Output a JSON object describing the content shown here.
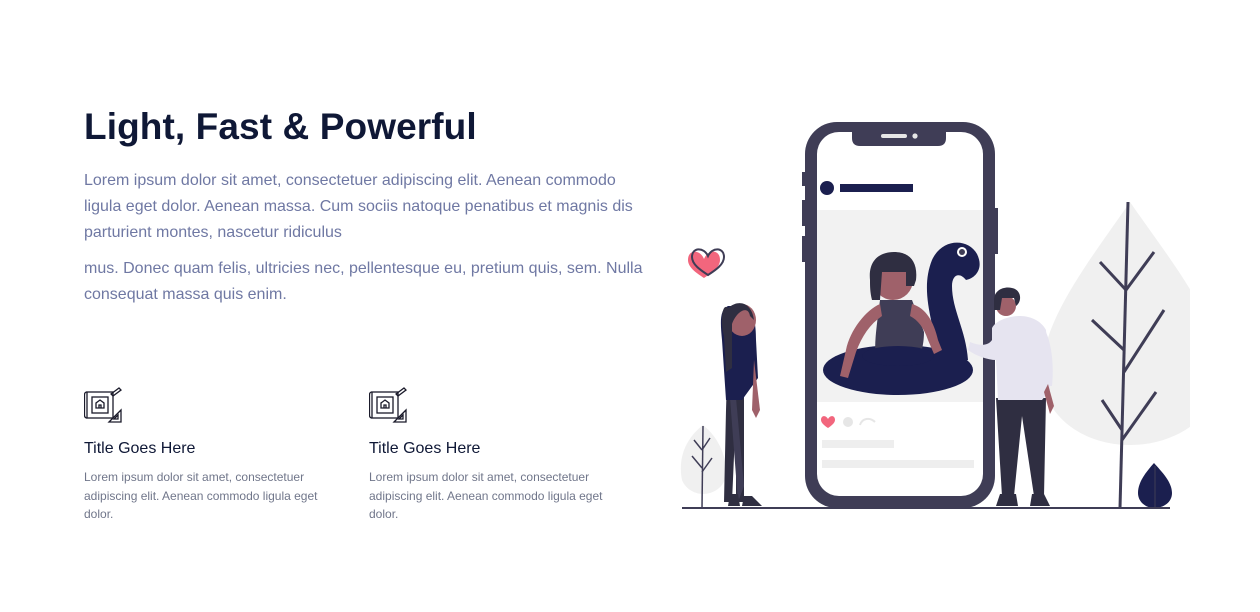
{
  "hero": {
    "title": "Light, Fast & Powerful",
    "paragraph_1": "Lorem ipsum dolor sit amet, consectetuer adipiscing elit. Aenean commodo ligula eget dolor. Aenean massa. Cum sociis natoque penatibus et magnis dis parturient montes, nascetur ridiculus",
    "paragraph_2": "mus. Donec quam felis, ultricies nec, pellentesque eu, pretium quis, sem. Nulla consequat massa quis enim."
  },
  "features": [
    {
      "icon": "blueprint-icon",
      "title": "Title Goes Here",
      "text": "Lorem ipsum dolor sit amet, consectetuer adipiscing elit. Aenean commodo ligula eget dolor."
    },
    {
      "icon": "blueprint-icon",
      "title": "Title Goes Here",
      "text": "Lorem ipsum dolor sit amet, consectetuer adipiscing elit. Aenean commodo ligula eget dolor."
    }
  ],
  "illustration": {
    "subject": "people-with-phone-illustration",
    "colors": {
      "navy": "#1b1f4f",
      "phone_frame": "#3f3d56",
      "heart": "#f2667d",
      "skin": "#9f616a",
      "shirt": "#e6e4f0",
      "foliage": "#f0f0f0"
    }
  }
}
